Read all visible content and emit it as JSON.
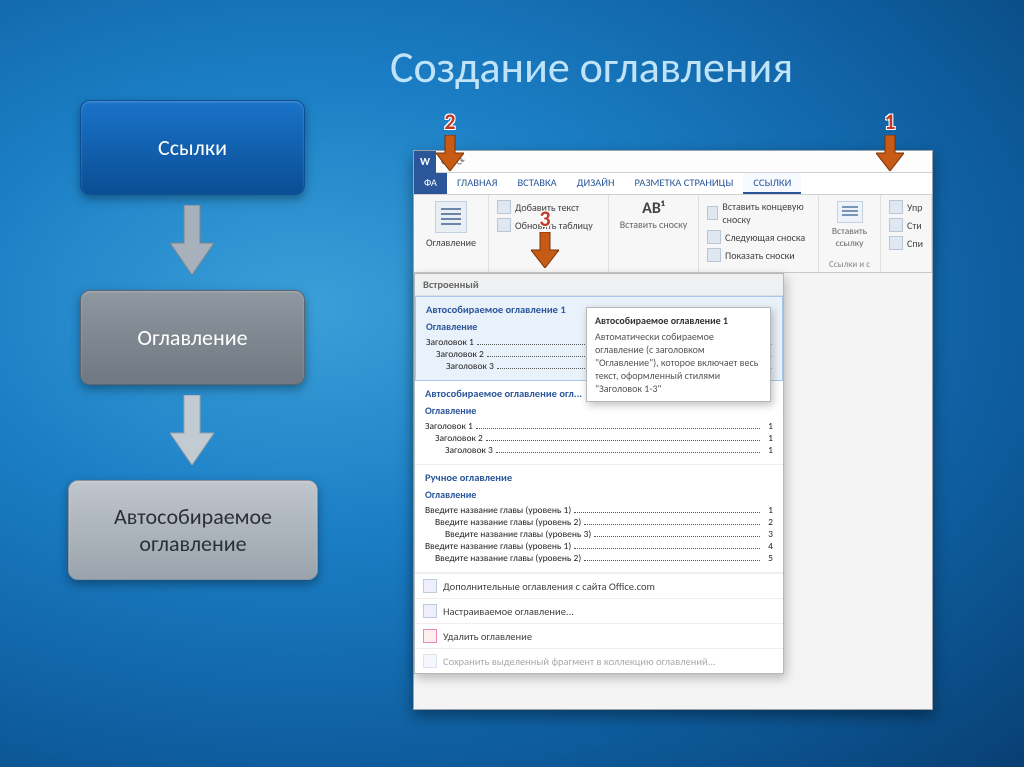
{
  "slide": {
    "title": "Создание оглавления",
    "flow": {
      "step1": "Ссылки",
      "step2": "Оглавление",
      "step3": "Автособираемое оглавление"
    }
  },
  "callouts": {
    "n1": "1",
    "n2": "2",
    "n3": "3"
  },
  "word": {
    "qat_hint": "↺  ⟳",
    "tabs": {
      "file": "ФА",
      "home": "ГЛАВНАЯ",
      "insert": "ВСТАВКА",
      "design": "ДИЗАЙН",
      "layout": "РАЗМЕТКА СТРАНИЦЫ",
      "references": "ССЫЛКИ"
    },
    "ribbon": {
      "toc_btn": "Оглавление",
      "add_text": "Добавить текст",
      "update_table": "Обновить таблицу",
      "ab": "AB¹",
      "insert_footnote": "Вставить сноску",
      "insert_endnote": "Вставить концевую сноску",
      "next_footnote": "Следующая сноска",
      "show_footnotes": "Показать сноски",
      "insert_link_btn": "Вставить ссылку",
      "upr": "Упр",
      "sti": "Сти",
      "spi": "Спи",
      "links_caption": "Ссылки и с"
    },
    "dropdown": {
      "header": "Встроенный",
      "auto1_title": "Автособираемое оглавление 1",
      "auto2_title": "Автособираемое оглавление огл...",
      "manual_title": "Ручное оглавление",
      "section_label": "Оглавление",
      "lines_auto": [
        {
          "t": "Заголовок 1",
          "indent": 0,
          "p": "1"
        },
        {
          "t": "Заголовок 2",
          "indent": 1,
          "p": "1"
        },
        {
          "t": "Заголовок 3",
          "indent": 2,
          "p": "1"
        }
      ],
      "lines_manual": [
        {
          "t": "Введите название главы (уровень 1)",
          "indent": 0,
          "p": "1"
        },
        {
          "t": "Введите название главы (уровень 2)",
          "indent": 1,
          "p": "2"
        },
        {
          "t": "Введите название главы (уровень 3)",
          "indent": 2,
          "p": "3"
        },
        {
          "t": "Введите название главы (уровень 1)",
          "indent": 0,
          "p": "4"
        },
        {
          "t": "Введите название главы (уровень 2)",
          "indent": 1,
          "p": "5"
        }
      ],
      "more_office": "Дополнительные оглавления с сайта Office.com",
      "custom": "Настраиваемое оглавление...",
      "remove": "Удалить оглавление",
      "save_sel": "Сохранить выделенный фрагмент в коллекцию оглавлений..."
    },
    "tooltip": {
      "title": "Автособираемое оглавление 1",
      "body": "Автоматически собираемое оглавление (с заголовком \"Оглавление\"), которое включает весь текст, оформленный стилями \"Заголовок 1-3\""
    }
  }
}
